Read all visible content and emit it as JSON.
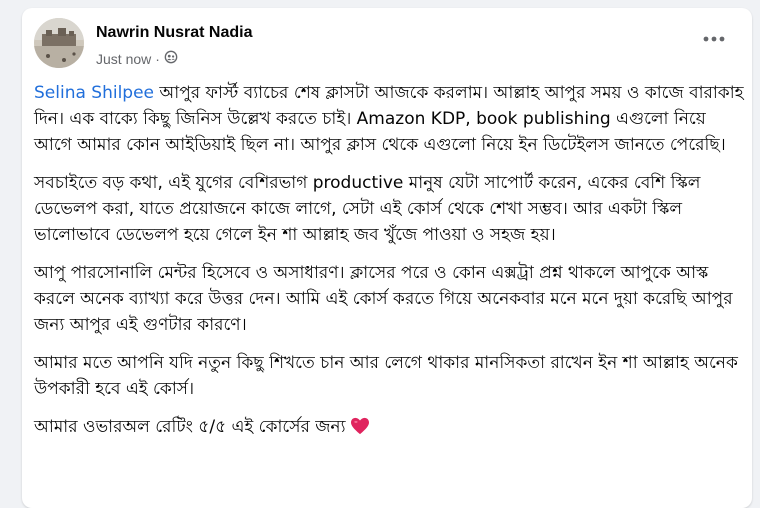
{
  "post": {
    "author": "Nawrin Nusrat Nadia",
    "time": "Just now",
    "separator": "·",
    "privacy_icon": "friends-icon",
    "more_icon": "more-icon",
    "mention": "Selina Shilpee",
    "paragraphs": {
      "p1_rest": " আপুর ফার্স্ট ব্যাচের শেষ ক্লাসটা আজকে করলাম। আল্লাহ আপুর সময় ও কাজে বারাকাহ দিন। এক বাক্যে কিছু জিনিস উল্লেখ করতে চাই। Amazon KDP, book publishing এগুলো নিয়ে আগে আমার কোন আইডিয়াই ছিল না। আপুর ক্লাস থেকে এগুলো নিয়ে ইন ডিটেইলস জানতে পেরেছি।",
      "p2": "সবচাইতে বড় কথা, এই যুগের বেশিরভাগ productive মানুষ যেটা সাপোর্ট করেন, একের বেশি স্কিল ডেভেলপ করা, যাতে প্রয়োজনে কাজে লাগে, সেটা এই কোর্স থেকে শেখা সম্ভব। আর একটা স্কিল ভালোভাবে ডেভেলপ হয়ে গেলে ইন শা আল্লাহ জব খুঁজে পাওয়া ও সহজ হয়।",
      "p3": "আপু পারসোনালি মেন্টর হিসেবে ও অসাধারণ। ক্লাসের পরে ও কোন এক্সট্রা প্রশ্ন থাকলে আপুকে আস্ক করলে অনেক ব্যাখ্যা করে উত্তর দেন। আমি এই কোর্স করতে গিয়ে অনেকবার মনে মনে দুয়া করেছি আপুর জন্য আপুর এই গুণটার কারণে।",
      "p4": "আমার মতে আপনি যদি নতুন কিছু শিখতে চান আর লেগে থাকার মানসিকতা রাখেন ইন শা আল্লাহ অনেক উপকারী হবে এই কোর্স।",
      "p5": "আমার ওভারঅল রেটিং ৫/৫ এই কোর্সের জন্য"
    },
    "heart_icon": "heart-icon",
    "heart_color": "#e0245e",
    "mention_color": "#216fdb"
  }
}
